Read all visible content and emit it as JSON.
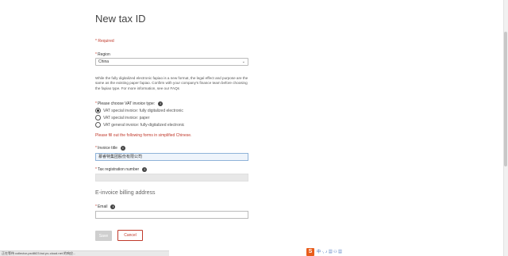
{
  "page": {
    "title": "New tax ID",
    "required_note": "* Required"
  },
  "region": {
    "label": "Region",
    "value": "China"
  },
  "description": "While the fully digitalized electronic fapiao is a new format, the legal effect and purpose are the same as the existing paper fapiao. Confirm with your company's finance team before choosing the fapiao type. For more information, see our FAQs",
  "invoice_type": {
    "label": "Please choose VAT invoice type:",
    "options": [
      {
        "label": "VAT special invoice: fully digitalized electronic",
        "checked": true
      },
      {
        "label": "VAT special invoice: paper",
        "checked": false
      },
      {
        "label": "VAT general invoice: fully-digitalized electronic",
        "checked": false
      }
    ]
  },
  "warning": "Please fill out the following forms in simplified Chinese.",
  "invoice_title": {
    "label": "Invoice title",
    "value": "慕睿特集团股份有限公司"
  },
  "tax_number": {
    "label": "Tax registration number",
    "value": ""
  },
  "billing_section": "E-invoice billing address",
  "email": {
    "label": "Email",
    "value": ""
  },
  "buttons": {
    "save": "Save",
    "cancel": "Cancel"
  },
  "statusbar": "正在等待 collector-pxd8t23.bui.pv-cloud.net 的响应...",
  "tray": {
    "logo": "S",
    "items": "中 ·, ♪ ▦ ⚇ ▦"
  },
  "colors": {
    "accent_red": "#c0392b",
    "focused_bg": "#eef4fb",
    "disabled_bg": "#e8e8e8"
  }
}
